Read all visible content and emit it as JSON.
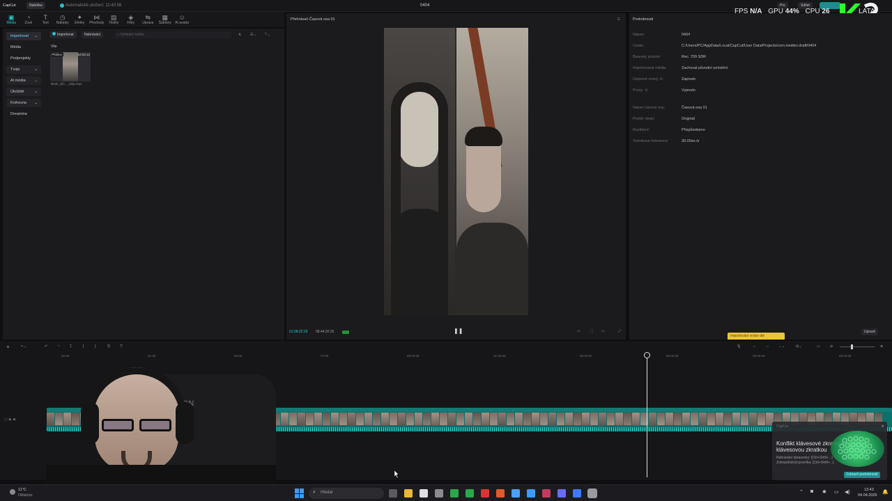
{
  "app": {
    "logo": "CapCut",
    "menu_label": "Nabídka",
    "autosave": "Automatické uložení: 11:40:58",
    "project_title": "0404",
    "pro_label": "Pro",
    "share_label": "Sdílet"
  },
  "overlay": {
    "fps_label": "FPS",
    "fps_value": "N/A",
    "gpu_label": "GPU",
    "gpu_value": "44",
    "gpu_unit": "%",
    "cpu_label": "CPU",
    "cpu_value": "26",
    "lat_label": "LATA",
    "brand_text": "K3"
  },
  "toolbar": {
    "tools": [
      {
        "label": "Média",
        "icon": "media-icon"
      },
      {
        "label": "Zvuk",
        "icon": "audio-icon"
      },
      {
        "label": "Text",
        "icon": "text-icon"
      },
      {
        "label": "Nálepky",
        "icon": "sticker-icon"
      },
      {
        "label": "Efekty",
        "icon": "effects-icon"
      },
      {
        "label": "Přechody",
        "icon": "transitions-icon"
      },
      {
        "label": "Titulky",
        "icon": "captions-icon"
      },
      {
        "label": "Filtry",
        "icon": "filters-icon"
      },
      {
        "label": "Úprava",
        "icon": "adjust-icon"
      },
      {
        "label": "Šablony",
        "icon": "templates-icon"
      },
      {
        "label": "AI avatar",
        "icon": "ai-avatar-icon"
      }
    ]
  },
  "sidebar": {
    "items": [
      {
        "label": "Importovat",
        "arrow": "⌄"
      },
      {
        "label": "Média",
        "arrow": ""
      },
      {
        "label": "Podprojekty",
        "arrow": ""
      },
      {
        "label": "Tvoje",
        "arrow": "⌄"
      },
      {
        "label": "AI média",
        "arrow": "→"
      },
      {
        "label": "Úložiště",
        "arrow": "⌄"
      },
      {
        "label": "Knihovna",
        "arrow": "⌄"
      },
      {
        "label": "Dreamina",
        "arrow": ""
      }
    ]
  },
  "media": {
    "import_button": "Importovat",
    "record_button": "Nahrávání",
    "search_placeholder": "Vyhledat média",
    "filter_label": "Vše",
    "clip_badge": "Přidáno",
    "clip_duration": "10:03:12",
    "clip_filename": "tiktok_@c..._9alp.mp4"
  },
  "player": {
    "title": "Přehrávač-Časová osa 01",
    "current_time": "01:08:22:29",
    "total_time": "08:44:20:25"
  },
  "details": {
    "title": "Podrobnosti",
    "rows": [
      {
        "key": "Název:",
        "value": "0404"
      },
      {
        "key": "Cesta:",
        "value": "C:/Users/PC/AppData/Local/CapCut/User Data/Projects/com.lveditor.draft/0404"
      },
      {
        "key": "Barevný prostor:",
        "value": "Rec. 709 SDR"
      },
      {
        "key": "Importovaná média:",
        "value": "Zachovat původní umístění"
      },
      {
        "key": "Úsporné vrstvy ①:",
        "value": "Zapnuto"
      },
      {
        "key": "Proxy: ①",
        "value": "Vypnuto"
      }
    ],
    "rows2": [
      {
        "key": "Název časové osy:",
        "value": "Časová osa 01"
      },
      {
        "key": "Poměr stran:",
        "value": "Originál"
      },
      {
        "key": "Rozlišení:",
        "value": "Přizpůsobeno"
      },
      {
        "key": "Snímková frekvence:",
        "value": "30.00sn./s"
      }
    ],
    "modify_button": "Upravit",
    "tooltip": "Importování vrstev dle"
  },
  "timeline": {
    "ruler": [
      "00:00",
      "01:00",
      "04:00",
      "07:00",
      "00:00:00",
      "01:00:00",
      "00:00:00",
      "00:00:00",
      "00:00:00",
      "00:00:00"
    ]
  },
  "toast": {
    "app": "CapCut",
    "title": "Konflikt klávesové zkratky s",
    "title2": "klávesovou zkratkou",
    "line1": "Nahrávání obrazovky: [Ctrl+Shift+...]",
    "line2": "Zobrazit/skrýt pravítka: [Ctrl+Shift+...]",
    "button": "Zobrazit podrobnosti"
  },
  "taskbar": {
    "weather_temp": "11°C",
    "weather_text": "Oblačno",
    "search_placeholder": "Hledat",
    "time": "13:43",
    "date": "04.04.2026"
  },
  "webcam": {
    "background_text": "TION"
  },
  "colors": {
    "accent": "#23c7c7",
    "tooltip_yellow": "#e9c53a",
    "brand_green": "#2aff2a"
  }
}
